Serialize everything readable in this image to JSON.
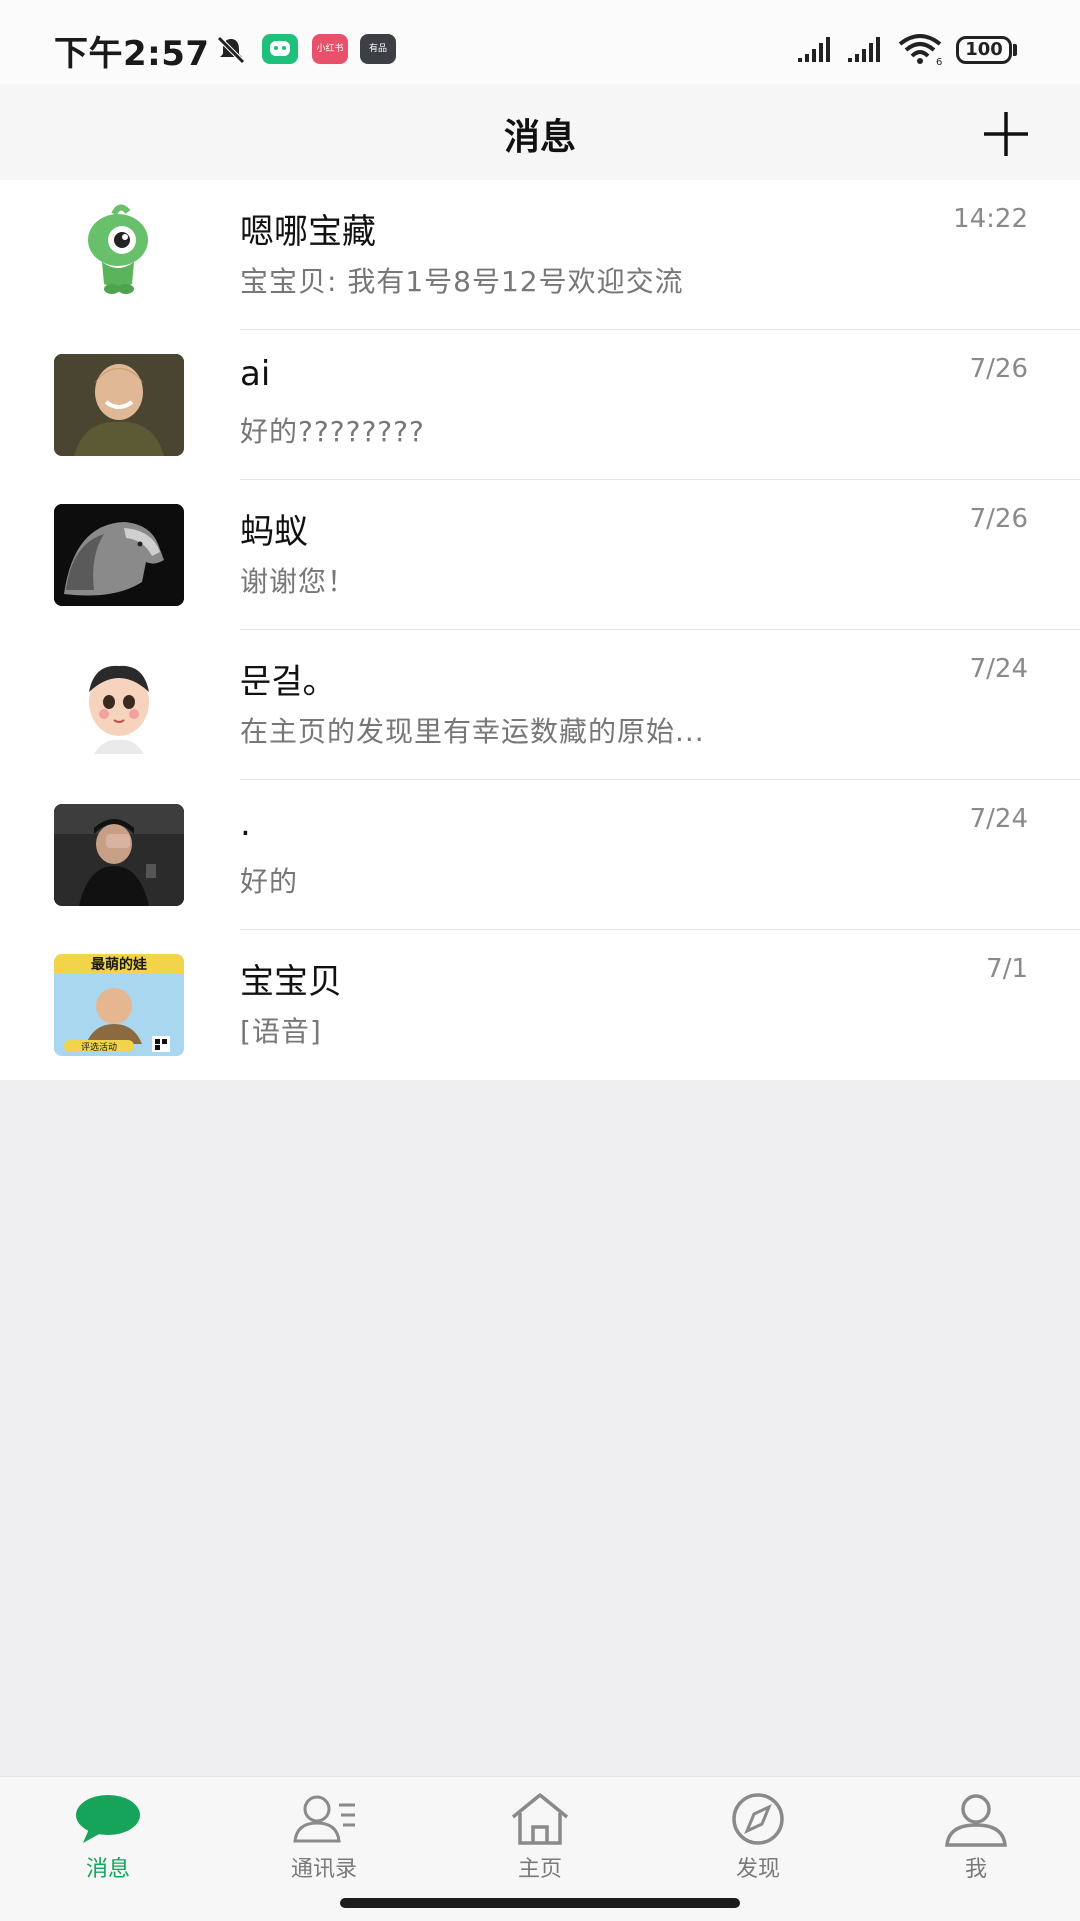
{
  "status_bar": {
    "time": "下午2:57",
    "badges": [
      {
        "label": "",
        "color": "#1fc07a"
      },
      {
        "label": "小红书",
        "color": "#e8516a"
      },
      {
        "label": "有品",
        "color": "#3c3f44"
      }
    ],
    "battery": "100"
  },
  "header": {
    "title": "消息"
  },
  "chats": [
    {
      "name": "嗯哪宝藏",
      "preview": "宝宝贝: 我有1号8号12号欢迎交流",
      "time": "14:22",
      "avatar": "green-mascot-avatar"
    },
    {
      "name": "ai",
      "preview": "好的????????",
      "time": "7/26",
      "avatar": "smiling-child-avatar"
    },
    {
      "name": "蚂蚁",
      "preview": "谢谢您！",
      "time": "7/26",
      "avatar": "lion-avatar"
    },
    {
      "name": "문걸。",
      "preview": "在主页的发现里有幸运数藏的原始...",
      "time": "7/24",
      "avatar": "cartoon-boy-avatar"
    },
    {
      "name": ".",
      "preview": "好的",
      "time": "7/24",
      "avatar": "person-in-car-avatar"
    },
    {
      "name": "宝宝贝",
      "preview": "[语音]",
      "time": "7/1",
      "avatar": "poster-avatar",
      "poster_text": "最萌的娃",
      "poster_sub": "评选活动"
    }
  ],
  "nav": [
    {
      "label": "消息",
      "icon": "chat-bubble-icon",
      "active": true
    },
    {
      "label": "通讯录",
      "icon": "contacts-icon",
      "active": false
    },
    {
      "label": "主页",
      "icon": "home-icon",
      "active": false
    },
    {
      "label": "发现",
      "icon": "compass-icon",
      "active": false
    },
    {
      "label": "我",
      "icon": "person-icon",
      "active": false
    }
  ],
  "colors": {
    "accent": "#16a35a",
    "background": "#efeff1"
  }
}
